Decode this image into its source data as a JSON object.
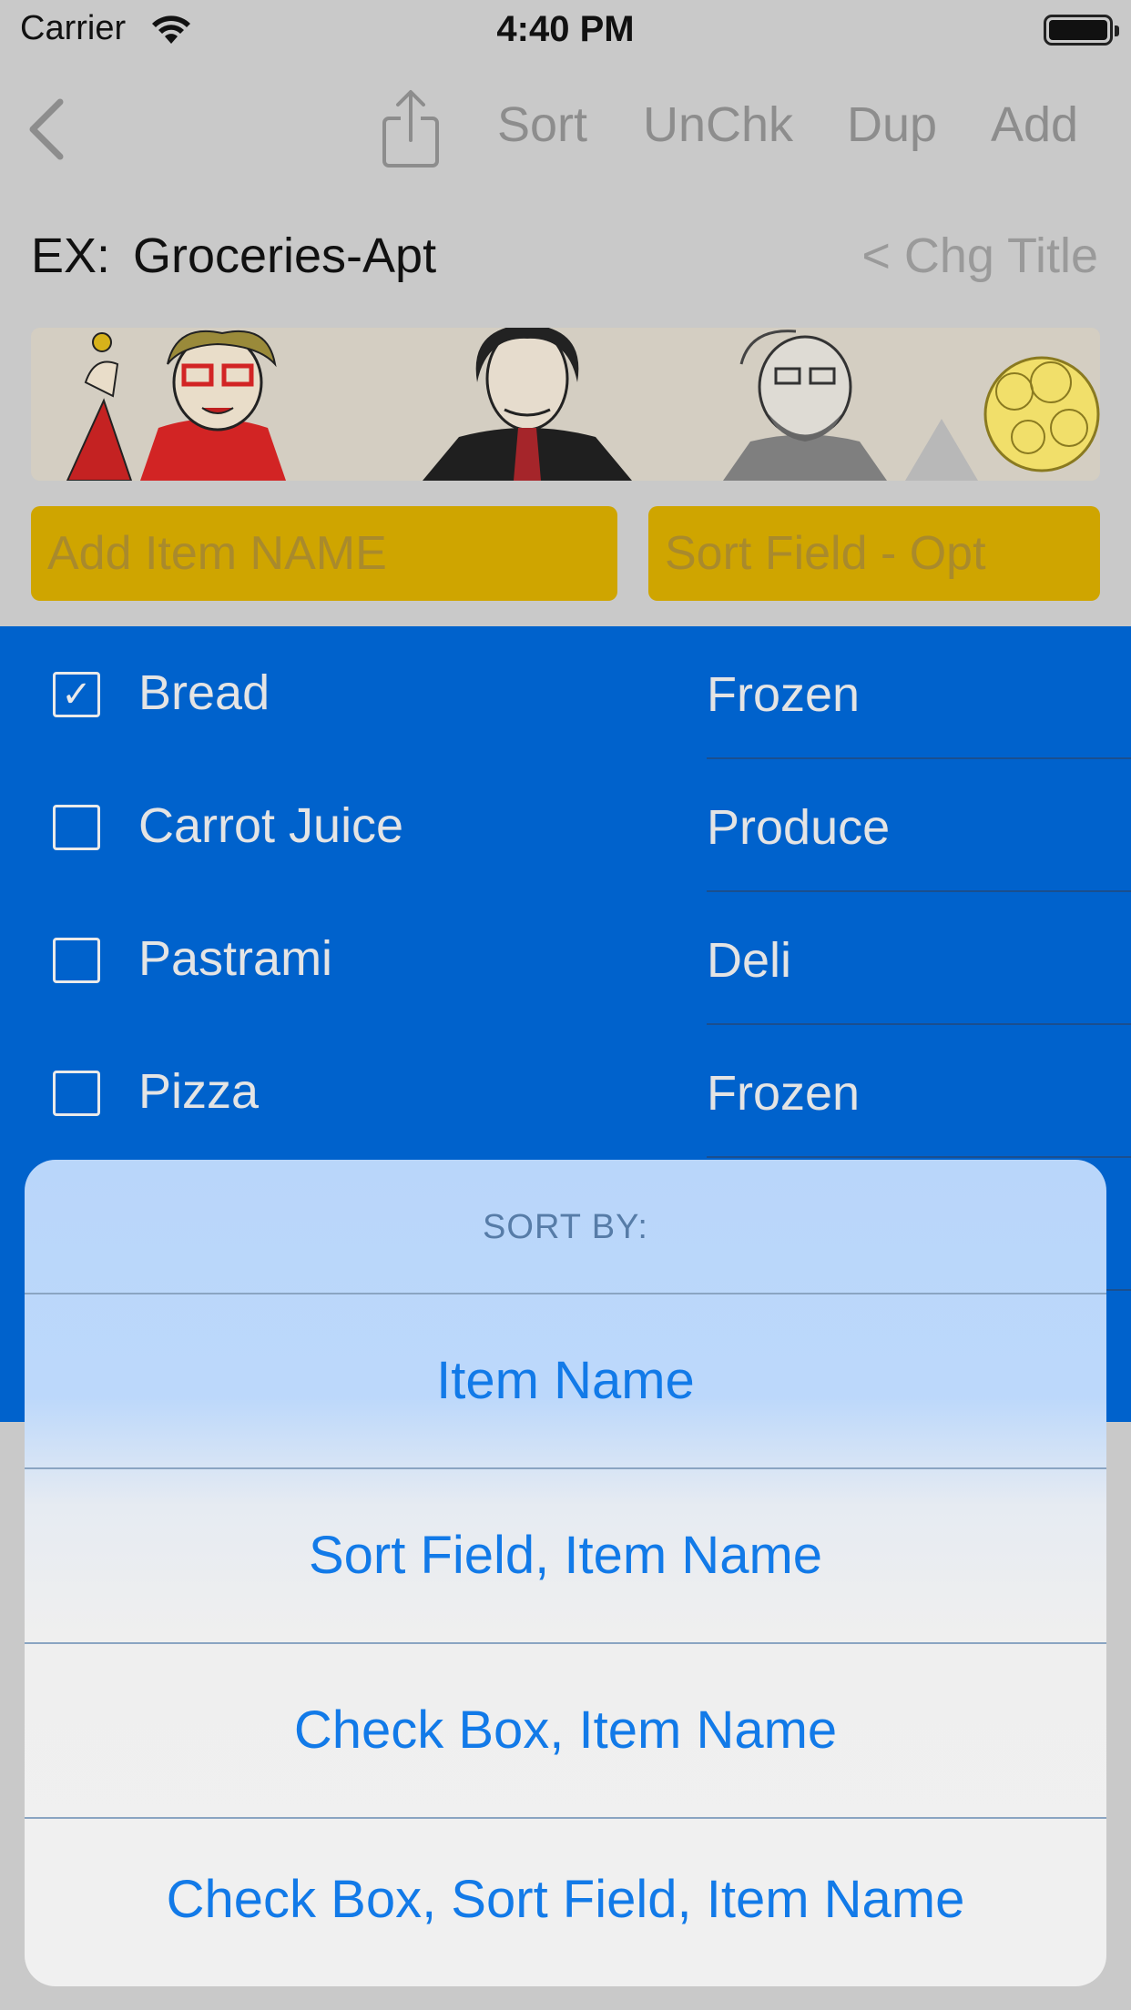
{
  "status_bar": {
    "carrier": "Carrier",
    "time": "4:40 PM"
  },
  "nav": {
    "sort": "Sort",
    "unchk": "UnChk",
    "dup": "Dup",
    "add": "Add"
  },
  "list_title": {
    "prefix": "EX:",
    "title": "Groceries-Apt",
    "change_title": "< Chg Title"
  },
  "inputs": {
    "item_name_placeholder": "Add Item NAME",
    "sort_field_placeholder": "Sort Field - Opt"
  },
  "items": [
    {
      "name": "Bread",
      "sort_field": "Frozen",
      "checked": true
    },
    {
      "name": "Carrot Juice",
      "sort_field": "Produce",
      "checked": false
    },
    {
      "name": "Pastrami",
      "sort_field": "Deli",
      "checked": false
    },
    {
      "name": "Pizza",
      "sort_field": "Frozen",
      "checked": false
    }
  ],
  "action_sheet": {
    "header": "SORT BY:",
    "options": [
      "Item Name",
      "Sort Field, Item Name",
      "Check Box, Item Name",
      "Check Box, Sort Field, Item Name"
    ]
  },
  "colors": {
    "input_bg": "#cfa500",
    "list_bg": "#0062cc",
    "action_text": "#127ae8"
  }
}
